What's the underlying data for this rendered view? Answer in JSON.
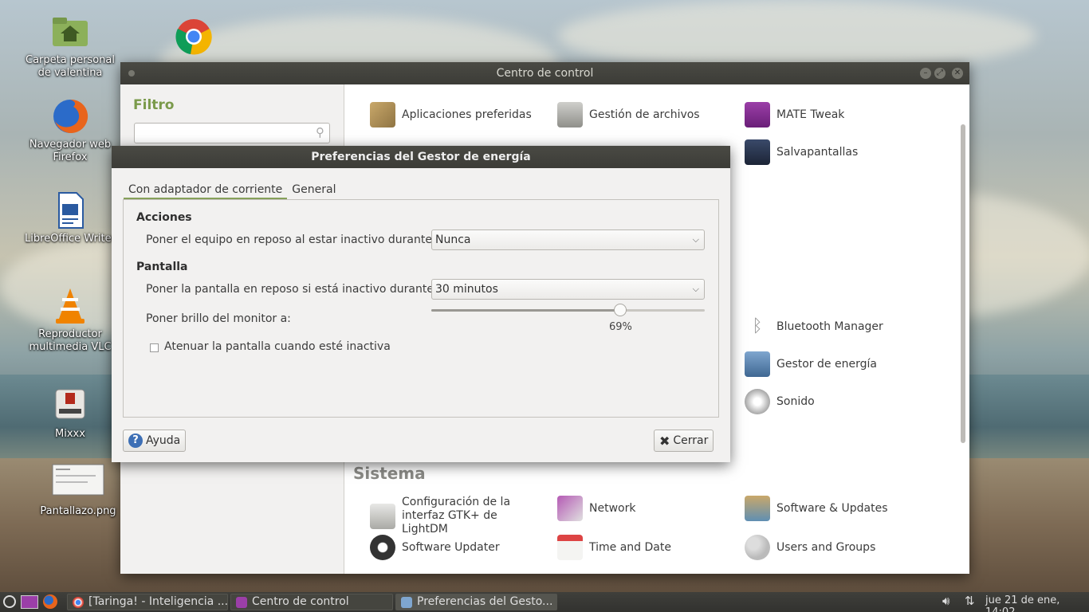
{
  "desktop": {
    "icons": [
      {
        "label": "Carpeta personal de valentina",
        "icon": "home-folder-icon"
      },
      {
        "label": "Google Chrome",
        "icon": "chrome-icon"
      },
      {
        "label": "Navegador web Firefox",
        "icon": "firefox-icon"
      },
      {
        "label": "LibreOffice Writer",
        "icon": "writer-icon"
      },
      {
        "label": "Reproductor multimedia VLC",
        "icon": "vlc-icon"
      },
      {
        "label": "Mixxx",
        "icon": "mixxx-icon"
      },
      {
        "label": "Pantallazo.png",
        "icon": "image-file-icon"
      }
    ]
  },
  "control_center": {
    "title": "Centro de control",
    "filter_title": "Filtro",
    "filter_value": "",
    "items": [
      {
        "label": "Aplicaciones preferidas"
      },
      {
        "label": "Gestión de archivos"
      },
      {
        "label": "MATE Tweak"
      },
      {
        "label": "Salvapantallas"
      },
      {
        "label": "Bluetooth Manager"
      },
      {
        "label": "Gestor de energía"
      },
      {
        "label": "Sonido"
      }
    ],
    "section_sistema": "Sistema",
    "sistema_items": [
      {
        "label": "Configuración de la interfaz GTK+ de LightDM"
      },
      {
        "label": "Network"
      },
      {
        "label": "Software & Updates"
      },
      {
        "label": "Software Updater"
      },
      {
        "label": "Time and Date"
      },
      {
        "label": "Users and Groups"
      }
    ]
  },
  "power_dialog": {
    "title": "Preferencias del Gestor de energía",
    "tabs": [
      "Con adaptador de corriente",
      "General"
    ],
    "active_tab": "Con adaptador de corriente",
    "section_actions": "Acciones",
    "sleep_label": "Poner el equipo en reposo al estar inactivo durante:",
    "sleep_value": "Nunca",
    "section_display": "Pantalla",
    "display_sleep_label": "Poner la pantalla en reposo si está inactivo durante:",
    "display_sleep_value": "30 minutos",
    "brightness_label": "Poner brillo del monitor a:",
    "brightness_text": "69%",
    "brightness_fraction": 0.69,
    "dim_label": "Atenuar la pantalla cuando esté inactiva",
    "dim_checked": false,
    "help_button": "Ayuda",
    "close_button": "Cerrar"
  },
  "taskbar": {
    "tasks": [
      {
        "label": "[Taringa! - Inteligencia ..."
      },
      {
        "label": "Centro de control"
      },
      {
        "label": "Preferencias del Gesto..."
      }
    ],
    "clock": "jue 21 de ene, 14:02"
  },
  "colors": {
    "accent": "#86a05a",
    "titlebar": "#3c3c37"
  }
}
